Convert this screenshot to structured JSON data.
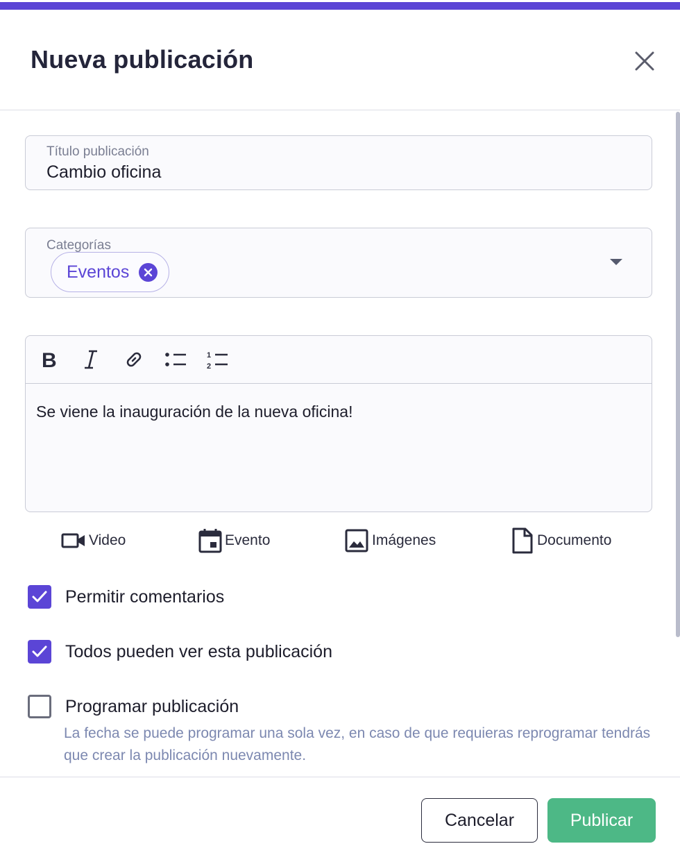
{
  "dialog": {
    "title": "Nueva publicación",
    "close_label": "close"
  },
  "title_field": {
    "label": "Título publicación",
    "value": "Cambio oficina"
  },
  "categories_field": {
    "label": "Categorías",
    "selected": [
      "Eventos"
    ]
  },
  "editor": {
    "toolbar": [
      {
        "name": "bold",
        "icon": "bold-icon"
      },
      {
        "name": "italic",
        "icon": "italic-icon"
      },
      {
        "name": "link",
        "icon": "link-icon"
      },
      {
        "name": "bullet-list",
        "icon": "bullet-list-icon"
      },
      {
        "name": "numbered-list",
        "icon": "numbered-list-icon"
      }
    ],
    "content": "Se viene la inauguración de la nueva oficina!"
  },
  "attachments": [
    {
      "label": "Video",
      "icon": "video-camera-icon"
    },
    {
      "label": "Evento",
      "icon": "calendar-icon"
    },
    {
      "label": "Imágenes",
      "icon": "image-icon"
    },
    {
      "label": "Documento",
      "icon": "document-icon"
    }
  ],
  "options": [
    {
      "label": "Permitir comentarios",
      "checked": true
    },
    {
      "label": "Todos pueden ver esta publicación",
      "checked": true
    },
    {
      "label": "Programar publicación",
      "checked": false
    }
  ],
  "schedule_helper": "La fecha se puede programar una sola vez, en caso de que requieras reprogramar tendrás que crear la publicación nuevamente.",
  "footer": {
    "cancel_label": "Cancelar",
    "publish_label": "Publicar"
  },
  "colors": {
    "accent": "#5b45d6",
    "publish": "#4db886",
    "helper_text": "#7c88b0"
  }
}
